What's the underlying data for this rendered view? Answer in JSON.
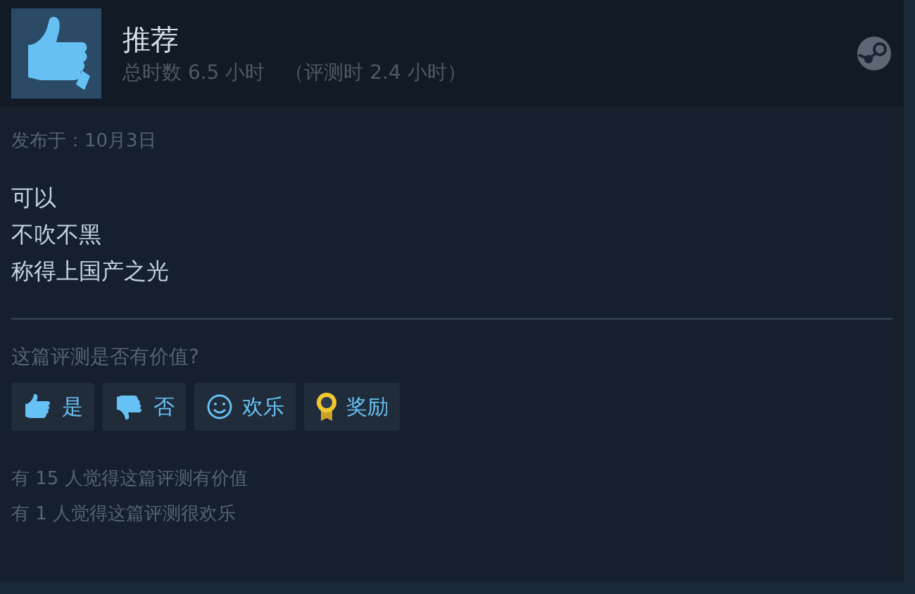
{
  "review": {
    "recommendation": "推荐",
    "hours": "总时数 6.5 小时",
    "review_hours": "（评测时 2.4 小时）",
    "posted": "发布于：10月3日",
    "lines": [
      "可以",
      "不吹不黑",
      "称得上国产之光"
    ],
    "question": "这篇评测是否有价值?",
    "buttons": [
      {
        "kind": "yes",
        "label": "是"
      },
      {
        "kind": "no",
        "label": "否"
      },
      {
        "kind": "funny",
        "label": "欢乐"
      },
      {
        "kind": "award",
        "label": "奖励"
      }
    ],
    "stats": [
      "有 15 人觉得这篇评测有价值",
      "有 1 人觉得这篇评测很欢乐"
    ]
  }
}
